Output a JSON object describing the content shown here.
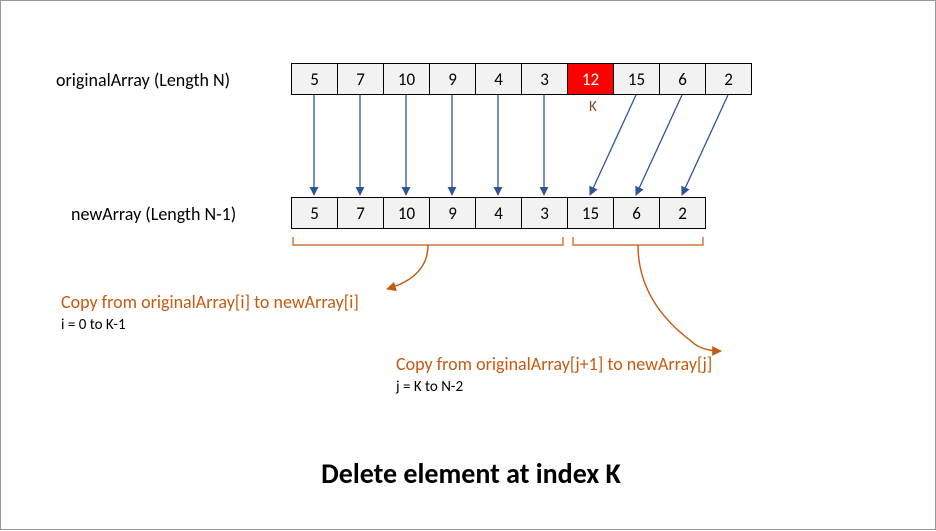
{
  "labels": {
    "originalArray": "originalArray (Length N)",
    "newArray": "newArray (Length N-1)",
    "kMarker": "K"
  },
  "original": {
    "values": [
      "5",
      "7",
      "10",
      "9",
      "4",
      "3",
      "12",
      "15",
      "6",
      "2"
    ],
    "highlightIndex": 6
  },
  "newArr": {
    "values": [
      "5",
      "7",
      "10",
      "9",
      "4",
      "3",
      "15",
      "6",
      "2"
    ]
  },
  "captions": {
    "left": "Copy from  originalArray[i] to  newArray[i]",
    "leftSub": "i = 0 to K-1",
    "right": "Copy from  originalArray[j+1] to  newArray[j]",
    "rightSub": "j = K to N-2"
  },
  "title": "Delete element at index K",
  "chart_data": {
    "type": "table",
    "title": "Delete element at index K",
    "rows": [
      {
        "name": "originalArray",
        "length": "N",
        "values": [
          5,
          7,
          10,
          9,
          4,
          3,
          12,
          15,
          6,
          2
        ],
        "delete_index_label": "K",
        "delete_index": 6
      },
      {
        "name": "newArray",
        "length": "N-1",
        "values": [
          5,
          7,
          10,
          9,
          4,
          3,
          15,
          6,
          2
        ]
      }
    ],
    "mappings": {
      "left_segment": {
        "rule": "newArray[i] = originalArray[i]",
        "i_range": "0 to K-1"
      },
      "right_segment": {
        "rule": "newArray[j] = originalArray[j+1]",
        "j_range": "K to N-2"
      }
    }
  }
}
